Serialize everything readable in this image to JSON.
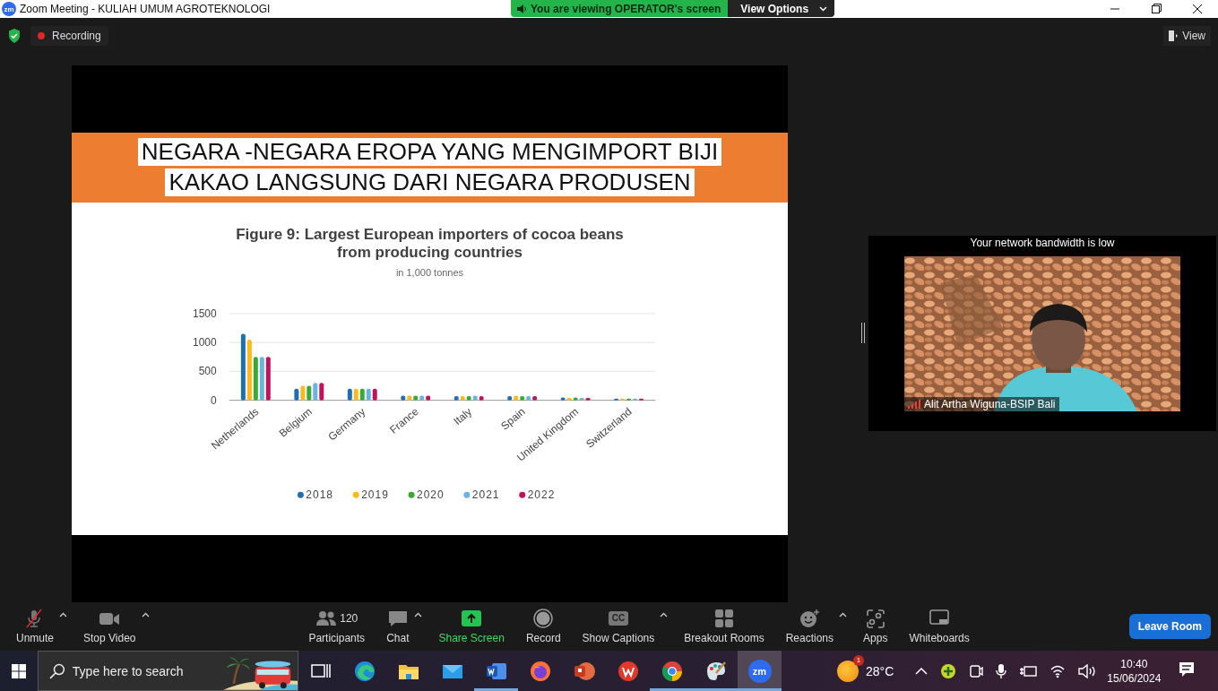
{
  "title_bar": {
    "app_icon": "zm",
    "title": "Zoom Meeting - KULIAH UMUM AGROTEKNOLOGI"
  },
  "share_banner": {
    "message": "You are viewing OPERATOR's screen",
    "button": "View Options"
  },
  "top_bar": {
    "recording": "Recording",
    "view_button": "View"
  },
  "slide": {
    "heading_lines": [
      "NEGARA -NEGARA EROPA YANG MENGIMPORT BIJI",
      "KAKAO LANGSUNG DARI NEGARA PRODUSEN"
    ],
    "figure_title_lines": [
      "Figure 9: Largest European importers of cocoa beans",
      "from producing countries"
    ],
    "subtitle": "in 1,000 tonnes",
    "chart_data": {
      "type": "bar",
      "categories": [
        "Netherlands",
        "Belgium",
        "Germany",
        "France",
        "Italy",
        "Spain",
        "United Kingdom",
        "Switzerland"
      ],
      "legend": "bottom",
      "ylim": [
        0,
        1500
      ],
      "yticks": [
        0,
        500,
        1000,
        1500
      ],
      "series": [
        {
          "name": "2018",
          "color": "#1f6fb4",
          "values": [
            1150,
            200,
            200,
            80,
            70,
            70,
            50,
            30
          ]
        },
        {
          "name": "2019",
          "color": "#fbb91a",
          "values": [
            1050,
            250,
            200,
            80,
            70,
            80,
            40,
            30
          ]
        },
        {
          "name": "2020",
          "color": "#3aaa35",
          "values": [
            750,
            250,
            200,
            80,
            70,
            70,
            50,
            30
          ]
        },
        {
          "name": "2021",
          "color": "#6ab4e0",
          "values": [
            750,
            300,
            200,
            80,
            80,
            70,
            40,
            30
          ]
        },
        {
          "name": "2022",
          "color": "#c4125a",
          "values": [
            750,
            300,
            200,
            80,
            70,
            70,
            40,
            30
          ]
        }
      ]
    }
  },
  "video_tile": {
    "notice": "Your network bandwidth is low",
    "participant_name": "Alit Artha Wiguna-BSIP Bali"
  },
  "toolbar": {
    "left_items": [
      {
        "kind": "mic",
        "label": "Unmute",
        "muted": true,
        "has_menu": true
      },
      {
        "kind": "video",
        "label": "Stop Video",
        "has_menu": true
      }
    ],
    "center_items": [
      {
        "kind": "participants",
        "label": "Participants",
        "count": "120",
        "has_menu": false
      },
      {
        "kind": "chat",
        "label": "Chat",
        "has_menu": true
      },
      {
        "kind": "share",
        "label": "Share Screen",
        "has_menu": false
      },
      {
        "kind": "record",
        "label": "Record",
        "has_menu": false
      },
      {
        "kind": "captions",
        "label": "Show Captions",
        "icon_text": "CC",
        "has_menu": true
      },
      {
        "kind": "breakout",
        "label": "Breakout Rooms",
        "has_menu": false
      },
      {
        "kind": "reactions",
        "label": "Reactions",
        "has_menu": true
      },
      {
        "kind": "apps",
        "label": "Apps",
        "has_menu": false
      },
      {
        "kind": "whiteboards",
        "label": "Whiteboards",
        "has_menu": false
      }
    ],
    "leave_button": "Leave Room"
  },
  "taskbar": {
    "search_placeholder": "Type here to search",
    "apps": [
      {
        "kind": "taskview",
        "running": false,
        "selected": false
      },
      {
        "kind": "edge",
        "running": false,
        "selected": false
      },
      {
        "kind": "explorer",
        "running": false,
        "selected": false
      },
      {
        "kind": "mail",
        "running": false,
        "selected": false
      },
      {
        "kind": "word",
        "running": true,
        "selected": false
      },
      {
        "kind": "firefox",
        "running": false,
        "selected": false
      },
      {
        "kind": "powerpoint",
        "running": false,
        "selected": false
      },
      {
        "kind": "wps",
        "running": false,
        "selected": false
      },
      {
        "kind": "chrome",
        "running": true,
        "selected": false
      },
      {
        "kind": "paint",
        "running": true,
        "selected": false
      },
      {
        "kind": "zoom",
        "label": "zm",
        "running": true,
        "selected": true
      }
    ],
    "weather": {
      "badge": "1",
      "temperature": "28°C"
    },
    "clock": {
      "time": "10:40",
      "date": "15/06/2024"
    }
  }
}
